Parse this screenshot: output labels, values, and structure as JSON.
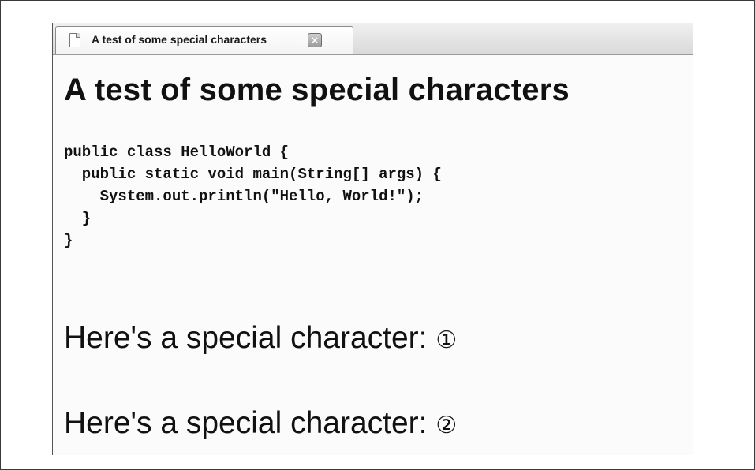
{
  "browser": {
    "tab": {
      "title": "A test of some special characters",
      "close_glyph": "×"
    }
  },
  "page": {
    "heading": "A test of some special characters",
    "code_lines": [
      "public class HelloWorld {",
      "  public static void main(String[] args) {",
      "    System.out.println(\"Hello, World!\");",
      "  }",
      "}"
    ],
    "special_lines": [
      {
        "text": "Here's a special character: ",
        "char": "①"
      },
      {
        "text": "Here's a special character: ",
        "char": "②"
      }
    ]
  },
  "icons": {
    "tab_icon": "page-icon",
    "close_icon": "close-icon"
  }
}
